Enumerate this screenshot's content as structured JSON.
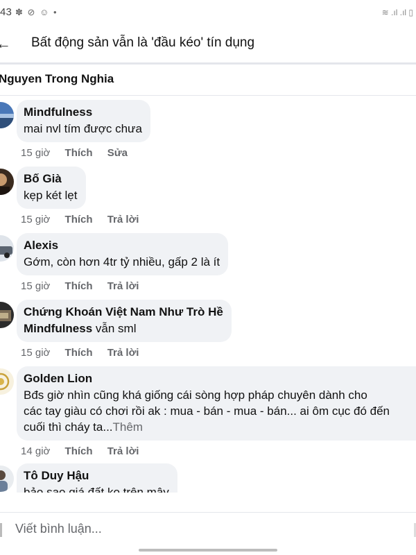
{
  "status_bar": {
    "time": "43",
    "left_icons": [
      "✽",
      "⊘",
      "☺",
      "•"
    ],
    "right_icons": "≋ .ıl .ıl ▯"
  },
  "header": {
    "title": "Bất động sản vẫn là 'đầu kéo' tín dụng"
  },
  "thread": {
    "author": "Nguyen Trong Nghia"
  },
  "comments": [
    {
      "name": "Mindfulness",
      "text": "mai nvl tím được chưa",
      "time": "15 giờ",
      "like": "Thích",
      "action2": "Sửa"
    },
    {
      "name": "Bố Già",
      "text": "kẹp két lẹt",
      "time": "15 giờ",
      "like": "Thích",
      "action2": "Trả lời"
    },
    {
      "name": "Alexis",
      "text": "Gớm, còn hơn 4tr tỷ nhiều, gấp 2 là ít",
      "time": "15 giờ",
      "like": "Thích",
      "action2": "Trả lời"
    },
    {
      "name": "Chứng Khoán Việt Nam Như Trò Hề",
      "mention": "Mindfulness",
      "text": "vẫn sml",
      "time": "15 giờ",
      "like": "Thích",
      "action2": "Trả lời"
    },
    {
      "name": "Golden Lion",
      "text_lines": [
        "Bđs giờ nhìn cũng khá giống cái sòng hợp pháp chuyên dành cho",
        "các tay giàu có chơi rồi ak : mua - bán - mua - bán... ai ôm cục đó đến",
        "cuối thì cháy ta..."
      ],
      "see_more": "Thêm",
      "time": "14 giờ",
      "like": "Thích",
      "action2": "Trả lời"
    },
    {
      "name": "Tô Duy Hậu",
      "text": "bảo sao giá đất ko trên mây"
    }
  ],
  "composer": {
    "placeholder": "Viết bình luận..."
  },
  "colors": {
    "bubble": "#f0f2f5",
    "secondary_text": "#65676b",
    "divider": "#e4e6eb"
  }
}
